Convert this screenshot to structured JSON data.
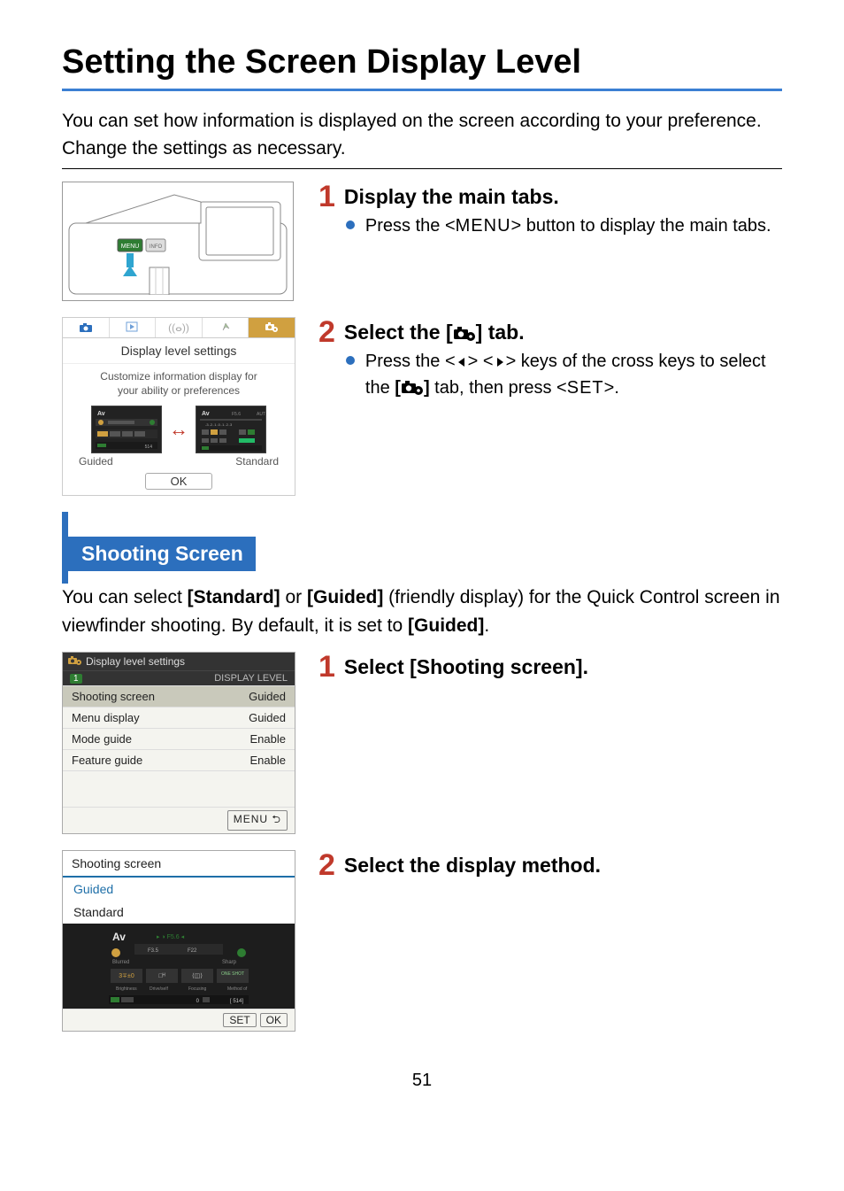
{
  "page_title": "Setting the Screen Display Level",
  "intro": "You can set how information is displayed on the screen according to your preference. Change the settings as necessary.",
  "steps_top": [
    {
      "number": "1",
      "heading": "Display the main tabs.",
      "bullet_pre": "Press the <",
      "bullet_key": "MENU",
      "bullet_post": "> button to display the main tabs."
    },
    {
      "number": "2",
      "heading_pre": "Select the [",
      "heading_post": "] tab.",
      "bullet_a": "Press the <",
      "bullet_b": "> <",
      "bullet_c": "> keys of the cross keys to select the ",
      "bullet_d": "[",
      "bullet_e": "]",
      "bullet_f": " tab, then press <",
      "bullet_g": "SET",
      "bullet_h": ">."
    }
  ],
  "dl": {
    "title": "Display level settings",
    "desc1": "Customize information display for",
    "desc2": "your ability or preferences",
    "guided": "Guided",
    "standard": "Standard",
    "ok": "OK"
  },
  "subsection": "Shooting Screen",
  "sub_intro_a": "You can select ",
  "sub_intro_b": "[Standard]",
  "sub_intro_c": " or ",
  "sub_intro_d": "[Guided]",
  "sub_intro_e": " (friendly display) for the Quick Control screen in viewfinder shooting. By default, it is set to ",
  "sub_intro_f": "[Guided]",
  "sub_intro_g": ".",
  "menu": {
    "head": "Display level settings",
    "head_right": "DISPLAY LEVEL",
    "rows": [
      {
        "label": "Shooting screen",
        "value": "Guided",
        "highlight": true
      },
      {
        "label": "Menu display",
        "value": "Guided",
        "highlight": false
      },
      {
        "label": "Mode guide",
        "value": "Enable",
        "highlight": false
      },
      {
        "label": "Feature guide",
        "value": "Enable",
        "highlight": false
      }
    ],
    "foot": "MENU ⮌",
    "sub_badge": "1"
  },
  "ss": {
    "title": "Shooting screen",
    "opt_guided": "Guided",
    "opt_standard": "Standard",
    "foot_set": "SET",
    "foot_ok": "OK",
    "preview_mode": "Av"
  },
  "steps_bottom": [
    {
      "number": "1",
      "heading": "Select [Shooting screen]."
    },
    {
      "number": "2",
      "heading": "Select the display method."
    }
  ],
  "page_number": "51"
}
